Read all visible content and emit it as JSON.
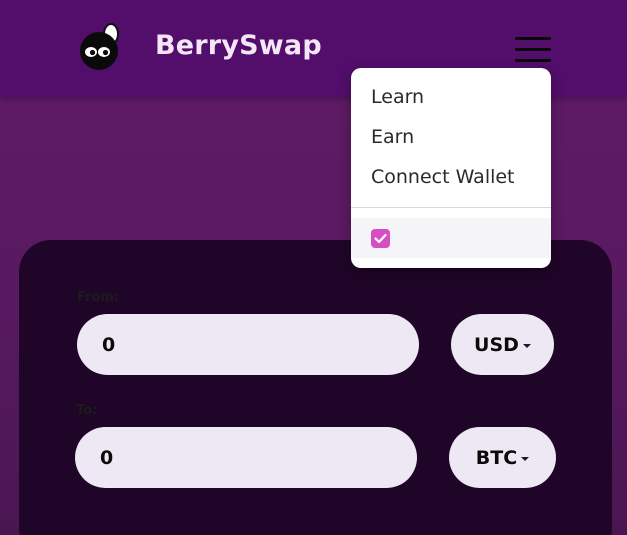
{
  "header": {
    "brand": "BerrySwap",
    "logo_icon": "berry-mascot-icon",
    "menu_icon": "hamburger-icon"
  },
  "menu": {
    "items": [
      {
        "label": "Learn"
      },
      {
        "label": "Earn"
      },
      {
        "label": "Connect Wallet"
      }
    ],
    "toggle_checked": true,
    "toggle_color": "#d54fc3"
  },
  "swap": {
    "from_label": "From:",
    "from_amount": "0",
    "from_currency": "USD",
    "to_label": "To:",
    "to_amount": "0",
    "to_currency": "BTC"
  },
  "colors": {
    "header_bg": "#530d6b",
    "page_bg": "#5a1a62",
    "card_bg": "#1f0528",
    "input_bg": "#ede8f4"
  }
}
